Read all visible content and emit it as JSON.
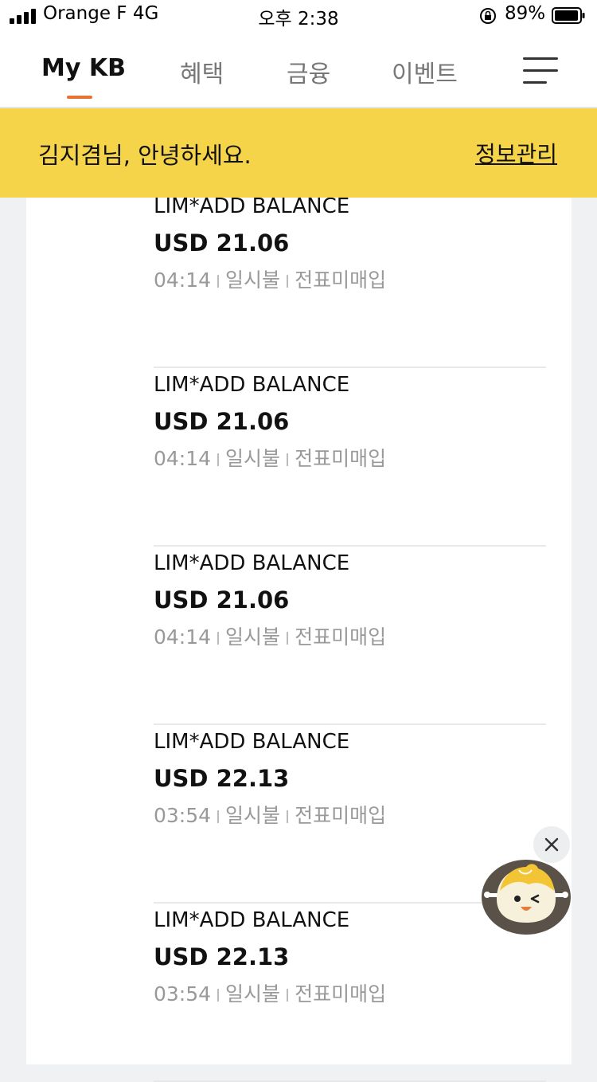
{
  "status_bar": {
    "carrier": "Orange F",
    "network": "4G",
    "time": "오후 2:38",
    "battery": "89%",
    "icons": [
      "signal-icon",
      "orientation-lock-icon",
      "battery-icon"
    ]
  },
  "nav": {
    "tabs": [
      {
        "label": "My KB",
        "active": true
      },
      {
        "label": "혜택",
        "active": false
      },
      {
        "label": "금융",
        "active": false
      },
      {
        "label": "이벤트",
        "active": false
      }
    ],
    "menu_icon": "menu-icon",
    "accent": "#e8732e"
  },
  "banner": {
    "greeting": "김지겸님, 안녕하세요.",
    "info_link": "정보관리",
    "color": "#f6d44a"
  },
  "transactions": [
    {
      "merchant": "LIM*ADD BALANCE",
      "amount": "USD 21.06",
      "time": "04:14",
      "installment": "일시불",
      "status": "전표미매입"
    },
    {
      "merchant": "LIM*ADD BALANCE",
      "amount": "USD 21.06",
      "time": "04:14",
      "installment": "일시불",
      "status": "전표미매입"
    },
    {
      "merchant": "LIM*ADD BALANCE",
      "amount": "USD 21.06",
      "time": "04:14",
      "installment": "일시불",
      "status": "전표미매입"
    },
    {
      "merchant": "LIM*ADD BALANCE",
      "amount": "USD 22.13",
      "time": "03:54",
      "installment": "일시불",
      "status": "전표미매입"
    },
    {
      "merchant": "LIM*ADD BALANCE",
      "amount": "USD 22.13",
      "time": "03:54",
      "installment": "일시불",
      "status": "전표미매입"
    }
  ],
  "floating": {
    "close_icon": "close-icon",
    "mascot_icon": "mascot-chatbot-icon"
  }
}
